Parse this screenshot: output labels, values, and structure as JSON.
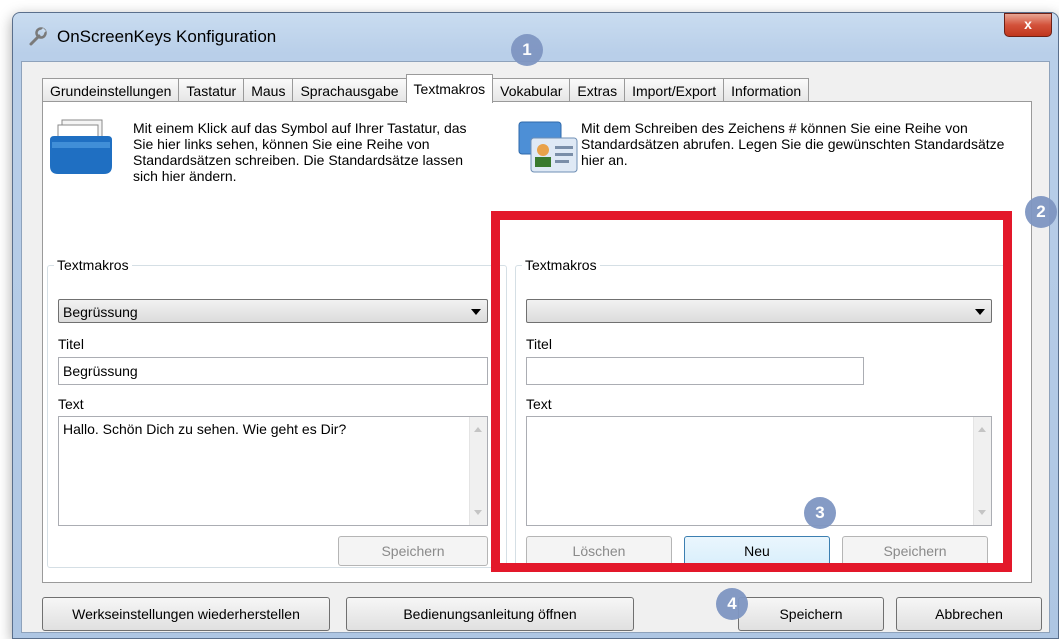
{
  "window": {
    "title": "OnScreenKeys Konfiguration",
    "close_label": "x"
  },
  "tabs": [
    {
      "label": "Grundeinstellungen"
    },
    {
      "label": "Tastatur"
    },
    {
      "label": "Maus"
    },
    {
      "label": "Sprachausgabe"
    },
    {
      "label": "Textmakros"
    },
    {
      "label": "Vokabular"
    },
    {
      "label": "Extras"
    },
    {
      "label": "Import/Export"
    },
    {
      "label": "Information"
    }
  ],
  "active_tab": "Textmakros",
  "left_intro": "Mit einem Klick auf das Symbol auf Ihrer Tastatur, das Sie hier links sehen, können Sie eine Reihe von Standardsätzen schreiben. Die Standardsätze lassen sich hier ändern.",
  "right_intro": "Mit dem Schreiben des Zeichens # können Sie eine Reihe von Standardsätzen abrufen. Legen Sie die gewünschten Standardsätze hier an.",
  "left_group": {
    "title": "Textmakros",
    "combo_value": "Begrüssung",
    "titel_label": "Titel",
    "titel_value": "Begrüssung",
    "text_label": "Text",
    "text_value": "Hallo. Schön Dich zu sehen. Wie geht es Dir?",
    "save_label": "Speichern"
  },
  "right_group": {
    "title": "Textmakros",
    "combo_value": "",
    "titel_label": "Titel",
    "titel_value": "",
    "text_label": "Text",
    "text_value": "",
    "delete_label": "Löschen",
    "new_label": "Neu",
    "save_label": "Speichern"
  },
  "footer": {
    "reset_label": "Werkseinstellungen wiederherstellen",
    "manual_label": "Bedienungsanleitung öffnen",
    "save_label": "Speichern",
    "cancel_label": "Abbrechen"
  },
  "steps": [
    "1",
    "2",
    "3",
    "4"
  ],
  "colors": {
    "highlight": "#e3182a",
    "step_badge": "#7f96c2"
  }
}
